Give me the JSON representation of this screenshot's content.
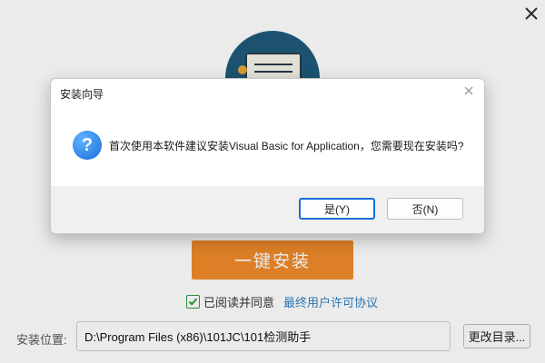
{
  "installer": {
    "one_click_label": "一键安装",
    "agree_text": "已阅读并同意",
    "license_link": "最终用户许可协议",
    "path_label": "安装位置:",
    "path_value": "D:\\Program Files (x86)\\101JC\\101检测助手",
    "browse_label": "更改目录...",
    "agree_checked": true,
    "accent_color": "#ef8a2b"
  },
  "dialog": {
    "title": "安装向导",
    "message": "首次使用本软件建议安装Visual Basic for Application，您需要现在安装吗?",
    "yes_label": "是(Y)",
    "no_label": "否(N)",
    "icon": "question-icon"
  }
}
